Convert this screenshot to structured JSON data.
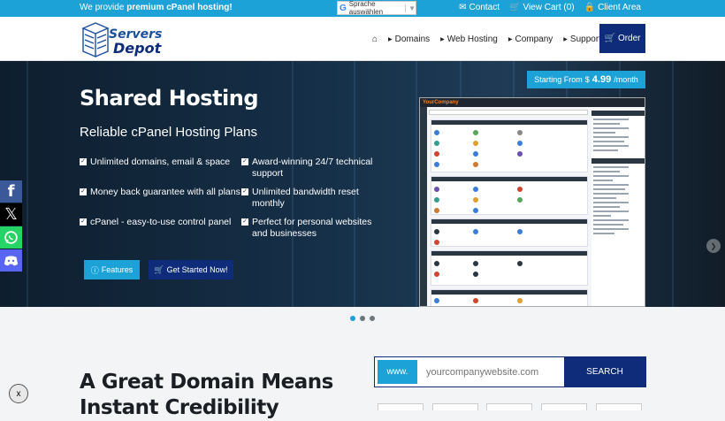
{
  "topbar": {
    "promo_prefix": "We provide ",
    "promo_bold": "premium cPanel hosting!",
    "language_label": "Sprache auswählen",
    "contact": "Contact",
    "cart": "View Cart (0)",
    "client_area": "Client Area"
  },
  "header": {
    "logo_line1": "Servers",
    "logo_line2": "Depot",
    "nav": [
      "Domains",
      "Web Hosting",
      "Company",
      "Support"
    ],
    "order_label": "Order"
  },
  "hero": {
    "title": "Shared Hosting",
    "subtitle": "Reliable cPanel Hosting Plans",
    "features": [
      "Unlimited domains, email & space",
      "Award-winning 24/7 technical support",
      "Money back guarantee with all plans",
      "Unlimited bandwidth reset monthly",
      "cPanel - easy-to-use control panel",
      "Perfect for personal websites and businesses"
    ],
    "btn_features": "Features",
    "btn_started": "Get Started Now!",
    "price_prefix": "Starting From",
    "price_currency": "$",
    "price_value": "4.99",
    "price_suffix": "/month",
    "mock_brand": "YourCompany"
  },
  "social": [
    "facebook-icon",
    "x-icon",
    "whatsapp-icon",
    "discord-icon"
  ],
  "domain": {
    "title": "A Great Domain Means Instant Credibility",
    "www": "www.",
    "placeholder": "yourcompanywebsite.com",
    "search_label": "SEARCH"
  },
  "colors": {
    "accent": "#1da2d8",
    "navy": "#0f2c7a"
  }
}
